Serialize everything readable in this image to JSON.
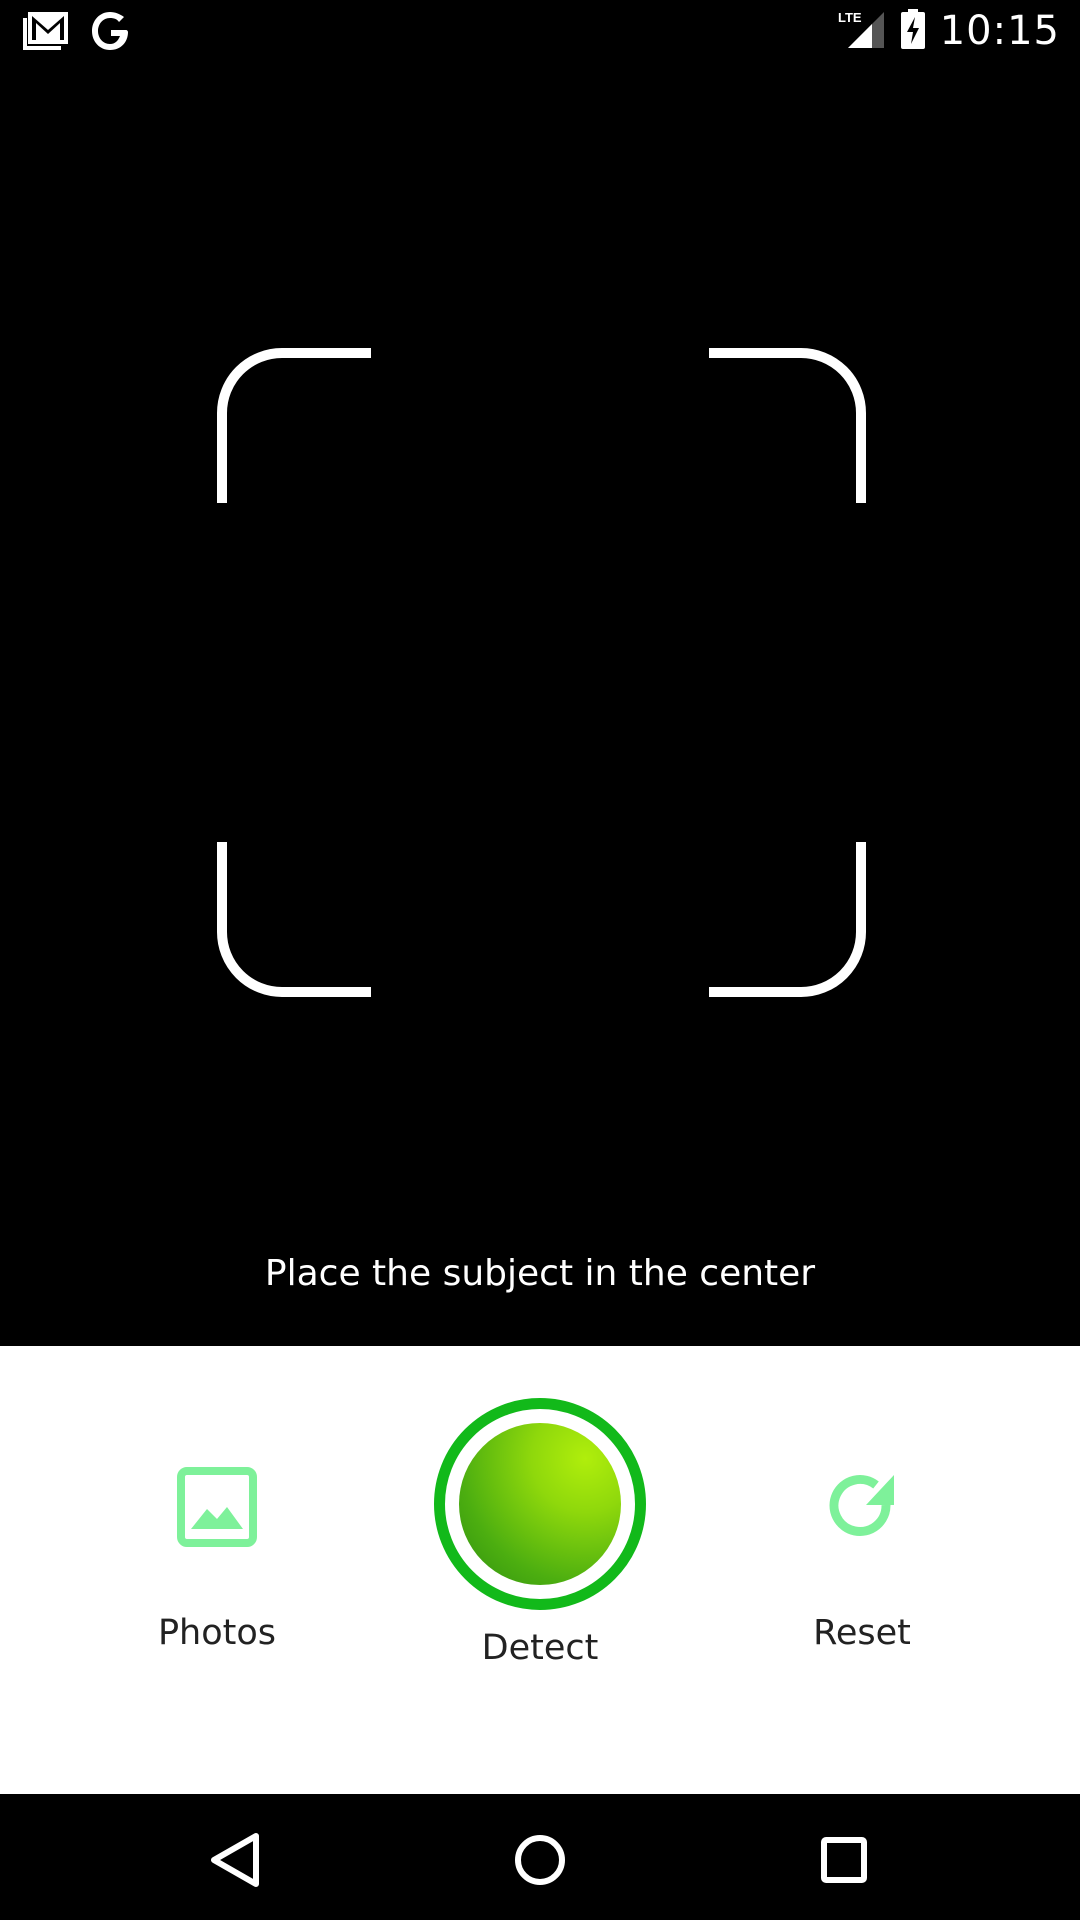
{
  "status_bar": {
    "time": "10:15",
    "network": "LTE",
    "icons": [
      "gmail-icon",
      "google-icon",
      "lte-signal-icon",
      "battery-charging-icon"
    ]
  },
  "viewfinder": {
    "hint": "Place the subject in the center"
  },
  "controls": {
    "photos_label": "Photos",
    "detect_label": "Detect",
    "reset_label": "Reset",
    "icons": {
      "photos": "image-icon",
      "reset": "refresh-icon"
    }
  },
  "colors": {
    "accent_light_green": "#7ef19a",
    "detect_ring": "#12b91a",
    "detect_fill": "#8fd80c"
  },
  "nav_bar": {
    "icons": [
      "back-icon",
      "home-icon",
      "recents-icon"
    ]
  }
}
